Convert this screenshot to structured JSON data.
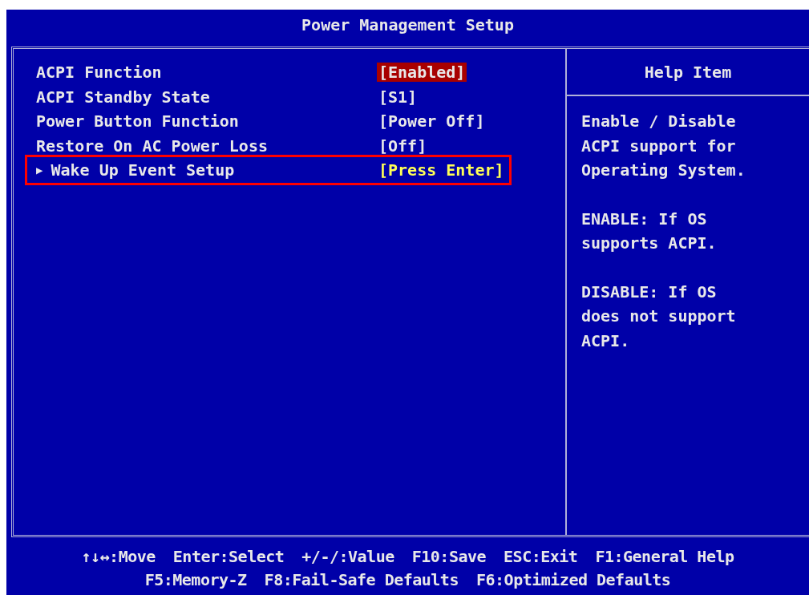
{
  "window": {
    "title": "Power Management Setup"
  },
  "settings": [
    {
      "label": "ACPI Function",
      "value": "[Enabled]",
      "selected": true,
      "submenu": false,
      "annotated": false
    },
    {
      "label": "ACPI Standby State",
      "value": "[S1]",
      "selected": false,
      "submenu": false,
      "annotated": false
    },
    {
      "label": "Power Button Function",
      "value": "[Power Off]",
      "selected": false,
      "submenu": false,
      "annotated": false
    },
    {
      "label": "Restore On AC Power Loss",
      "value": "[Off]",
      "selected": false,
      "submenu": false,
      "annotated": false
    },
    {
      "label": "Wake Up Event Setup",
      "value": "[Press Enter]",
      "selected": false,
      "submenu": true,
      "marker": "▶",
      "annotated": true
    }
  ],
  "help": {
    "title": "Help Item",
    "paragraphs": [
      [
        "Enable / Disable",
        "ACPI support for",
        "Operating System."
      ],
      [
        "ENABLE: If OS",
        "supports ACPI."
      ],
      [
        "DISABLE: If OS",
        "does not support",
        "ACPI."
      ]
    ]
  },
  "key_legend": [
    [
      "↑↓↔:Move",
      "Enter:Select",
      "+/-/:Value",
      "F10:Save",
      "ESC:Exit",
      "F1:General Help"
    ],
    [
      "F5:Memory-Z",
      "F8:Fail-Safe Defaults",
      "F6:Optimized Defaults"
    ]
  ]
}
